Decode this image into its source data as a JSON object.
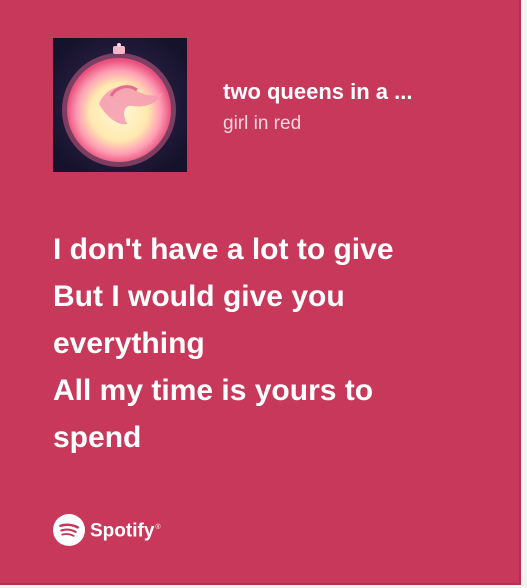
{
  "track": {
    "title": "two queens in a ...",
    "artist": "girl in red"
  },
  "lyrics": [
    "I don't have a lot to give",
    "But I would give you",
    "everything",
    "All my time is yours to",
    "spend"
  ],
  "branding": {
    "name": "Spotify",
    "mark": "®",
    "icon": "spotify-logo-icon"
  },
  "colors": {
    "card_background": "#c8385a",
    "text": "#ffffff",
    "artist_text": "#f4d6de"
  }
}
